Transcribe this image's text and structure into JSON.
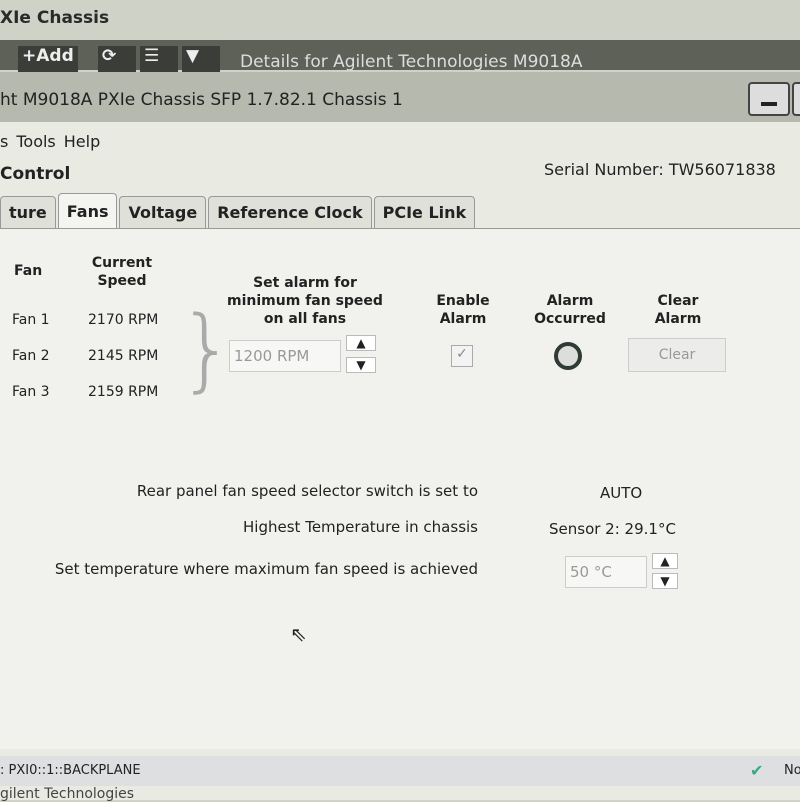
{
  "background": {
    "title": "XIe Chassis",
    "toolbar": {
      "add": "+Add",
      "refresh_icon": "refresh-icon",
      "list_icon": "list-icon",
      "filter_icon": "filter-icon"
    },
    "details": "Details for Agilent Technologies M9018A",
    "footer": "gilent Technologies"
  },
  "window": {
    "title": "ht M9018A PXIe Chassis SFP 1.7.82.1 Chassis 1",
    "minimize_icon": "minimize-icon"
  },
  "menu": [
    "s",
    "Tools",
    "Help"
  ],
  "heading": "Control",
  "serial": "Serial Number: TW56071838",
  "tabs": [
    {
      "label": "ture"
    },
    {
      "label": "Fans",
      "active": true
    },
    {
      "label": "Voltage"
    },
    {
      "label": "Reference Clock"
    },
    {
      "label": "PCIe Link"
    }
  ],
  "fans": {
    "headers": {
      "fan": "Fan",
      "speed": "Current Speed",
      "alarm_set": "Set alarm for minimum fan speed on all fans",
      "enable": "Enable Alarm",
      "occurred": "Alarm Occurred",
      "clear": "Clear Alarm"
    },
    "rows": [
      {
        "name": "Fan 1",
        "speed": "2170 RPM"
      },
      {
        "name": "Fan 2",
        "speed": "2145 RPM"
      },
      {
        "name": "Fan 3",
        "speed": "2159 RPM"
      }
    ],
    "alarm_value": "1200 RPM",
    "enable_checked": true,
    "clear_label": "Clear"
  },
  "info": [
    {
      "label": "Rear panel fan speed selector switch is set to",
      "value": "AUTO"
    },
    {
      "label": "Highest Temperature in chassis",
      "value": "Sensor 2: 29.1°C"
    },
    {
      "label": "Set temperature where maximum fan speed is achieved",
      "value": "50 °C"
    }
  ],
  "status": {
    "resource": ": PXI0::1::BACKPLANE",
    "right": "No"
  }
}
